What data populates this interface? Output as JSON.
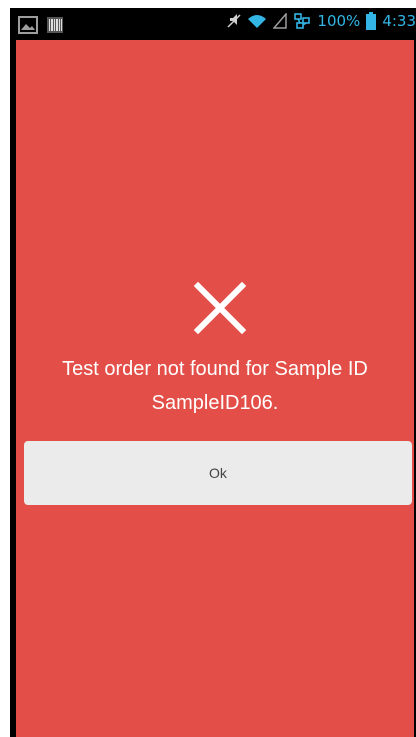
{
  "status_bar": {
    "battery_percent": "100%",
    "time": "4:33",
    "color": "#33b5e5",
    "icons": [
      "gallery-icon",
      "barcode-icon",
      "mute-icon",
      "wifi-icon",
      "signal-icon",
      "network-icon",
      "battery-icon"
    ]
  },
  "screen": {
    "background_color": "#e34f48",
    "error_icon": "close-icon",
    "message_line1": "Test order not found for Sample ID",
    "message_line2": "SampleID106.",
    "ok_label": "Ok"
  }
}
